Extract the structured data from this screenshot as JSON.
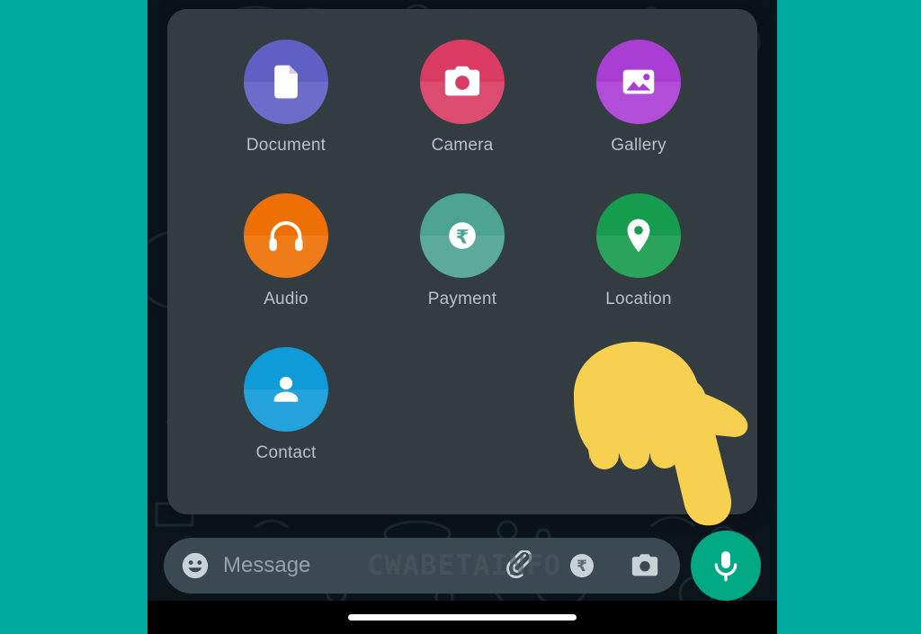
{
  "theme": {
    "outer_background": "#00a99d",
    "chat_background": "#0b141a",
    "panel_background": "#333c41",
    "input_background": "#3b4a52",
    "accent_teal": "#00a884",
    "label_color": "#b8c2c6",
    "placeholder_color": "#93a3ab"
  },
  "attachment_panel": {
    "items": [
      {
        "label": "Document",
        "icon": "document-icon",
        "color": "#5f5fc4"
      },
      {
        "label": "Camera",
        "icon": "camera-icon",
        "color": "#d93b63"
      },
      {
        "label": "Gallery",
        "icon": "gallery-icon",
        "color": "#aa3dd4"
      },
      {
        "label": "Audio",
        "icon": "headphones-icon",
        "color": "#ee7004"
      },
      {
        "label": "Payment",
        "icon": "rupee-icon",
        "color": "#4ca392"
      },
      {
        "label": "Location",
        "icon": "location-pin-icon",
        "color": "#169c4e"
      },
      {
        "label": "Contact",
        "icon": "person-icon",
        "color": "#0f9ad8"
      }
    ]
  },
  "input_bar": {
    "emoji_icon": "smiley-icon",
    "placeholder": "Message",
    "attach_icon": "paperclip-icon",
    "payment_icon": "rupee-circle-icon",
    "camera_icon": "camera-icon",
    "mic_icon": "microphone-icon"
  },
  "overlay": {
    "watermark": "CWABETAINFO",
    "cursor": "pointing-down-hand-emoji"
  },
  "nav_bar": {
    "home_indicator": "home-indicator-pill"
  }
}
